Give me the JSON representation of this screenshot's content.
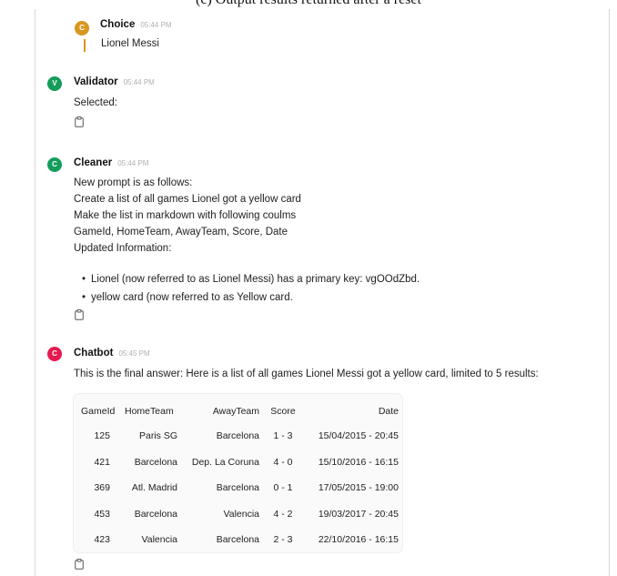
{
  "caption": "(c) Output results returned after a reset",
  "messages": [
    {
      "sender": "Choice",
      "avatar_letter": "C",
      "avatar_color": "#d9961f",
      "time": "05:44 PM",
      "quote": "Lionel Messi"
    },
    {
      "sender": "Validator",
      "avatar_letter": "V",
      "avatar_color": "#149c5b",
      "time": "05:44 PM",
      "lines": [
        "Selected:"
      ]
    },
    {
      "sender": "Cleaner",
      "avatar_letter": "C",
      "avatar_color": "#149c5b",
      "time": "05:44 PM",
      "lines": [
        "New prompt is as follows:",
        "Create a list of all games Lionel got a yellow card",
        "Make the list in markdown with following coulms",
        "GameId, HomeTeam, AwayTeam, Score, Date",
        "Updated Information:"
      ],
      "bullets": [
        "Lionel (now referred to as Lionel Messi) has a primary key: vgOOdZbd.",
        "yellow card (now referred to as Yellow card."
      ]
    },
    {
      "sender": "Chatbot",
      "avatar_letter": "C",
      "avatar_color": "#e8194f",
      "time": "05:45 PM",
      "lines": [
        "This is the final answer: Here is a list of all games Lionel Messi got a yellow card, limited to 5 results:"
      ],
      "table": {
        "headers": [
          "GameId",
          "HomeTeam",
          "AwayTeam",
          "Score",
          "Date"
        ],
        "rows": [
          [
            "125",
            "Paris SG",
            "Barcelona",
            "1 - 3",
            "15/04/2015 - 20:45"
          ],
          [
            "421",
            "Barcelona",
            "Dep. La Coruna",
            "4 - 0",
            "15/10/2016 - 16:15"
          ],
          [
            "369",
            "Atl. Madrid",
            "Barcelona",
            "0 - 1",
            "17/05/2015 - 19:00"
          ],
          [
            "453",
            "Barcelona",
            "Valencia",
            "4 - 2",
            "19/03/2017 - 20:45"
          ],
          [
            "423",
            "Valencia",
            "Barcelona",
            "2 - 3",
            "22/10/2016 - 16:15"
          ]
        ]
      }
    }
  ],
  "icons": {
    "copy": "clipboard-icon"
  }
}
